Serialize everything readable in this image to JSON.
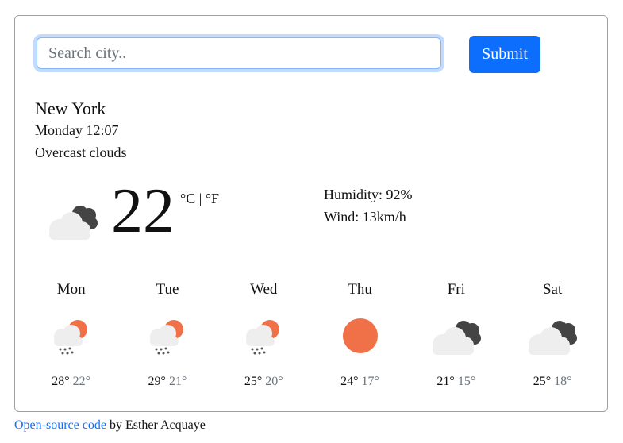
{
  "search": {
    "placeholder": "Search city..",
    "submit_label": "Submit"
  },
  "current": {
    "city": "New York",
    "datetime": "Monday 12:07",
    "description": "Overcast clouds",
    "icon": "overcast-clouds-icon",
    "temperature": "22",
    "unit_celsius": "°C",
    "unit_separator": " | ",
    "unit_fahrenheit": "°F",
    "humidity": "Humidity: 92%",
    "wind": "Wind: 13km/h"
  },
  "forecast": [
    {
      "day": "Mon",
      "icon": "rain-sun-cloud-icon",
      "max": "28°",
      "min": "22°"
    },
    {
      "day": "Tue",
      "icon": "rain-sun-cloud-icon",
      "max": "29°",
      "min": "21°"
    },
    {
      "day": "Wed",
      "icon": "rain-sun-cloud-icon",
      "max": "25°",
      "min": "20°"
    },
    {
      "day": "Thu",
      "icon": "sun-icon",
      "max": "24°",
      "min": "17°"
    },
    {
      "day": "Fri",
      "icon": "overcast-clouds-icon",
      "max": "21°",
      "min": "15°"
    },
    {
      "day": "Sat",
      "icon": "overcast-clouds-icon",
      "max": "25°",
      "min": "18°"
    }
  ],
  "footer": {
    "link_text": "Open-source code",
    "suffix": " by Esther Acquaye"
  },
  "colors": {
    "accent": "#0d6efd",
    "sun": "#f07048",
    "dark_cloud": "#444444",
    "light_cloud": "#eeeeee"
  }
}
